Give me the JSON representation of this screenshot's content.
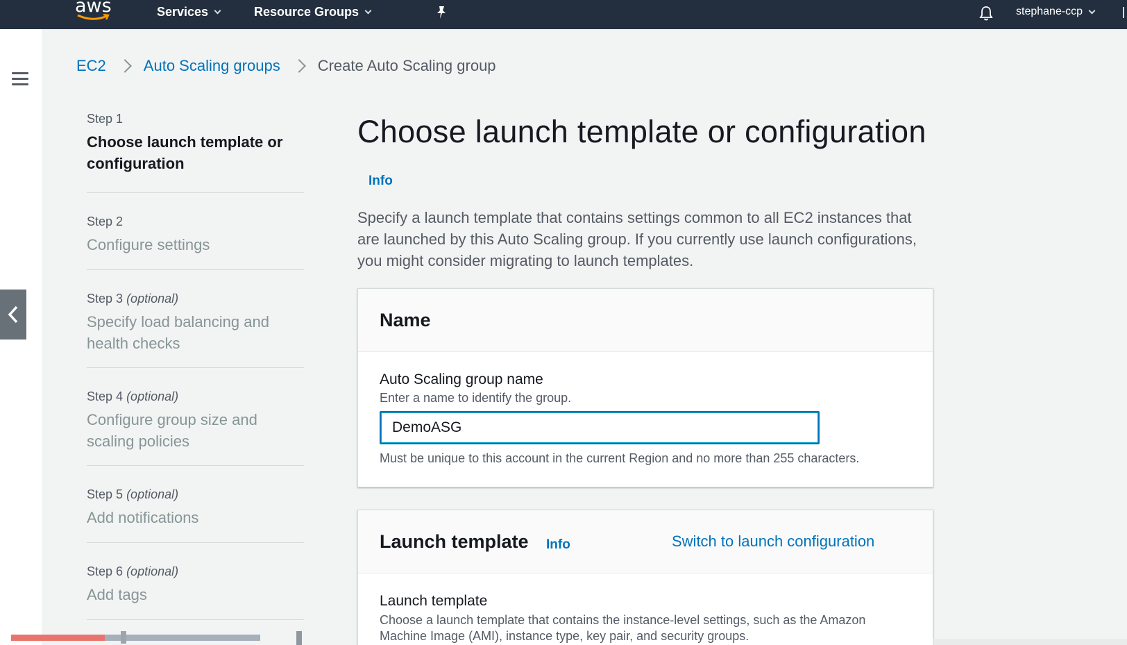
{
  "topnav": {
    "logo": "aws",
    "services": "Services",
    "resource_groups": "Resource Groups",
    "user": "stephane-ccp",
    "icons": [
      "pin-icon",
      "bell-icon"
    ]
  },
  "breadcrumb": {
    "items": [
      "EC2",
      "Auto Scaling groups"
    ],
    "current": "Create Auto Scaling group"
  },
  "steps": [
    {
      "num": "Step 1",
      "optional": "",
      "title": "Choose launch template or configuration"
    },
    {
      "num": "Step 2",
      "optional": "",
      "title": "Configure settings"
    },
    {
      "num": "Step 3",
      "optional": "(optional)",
      "title": "Specify load balancing and health checks"
    },
    {
      "num": "Step 4",
      "optional": "(optional)",
      "title": "Configure group size and scaling policies"
    },
    {
      "num": "Step 5",
      "optional": "(optional)",
      "title": "Add notifications"
    },
    {
      "num": "Step 6",
      "optional": "(optional)",
      "title": "Add tags"
    }
  ],
  "main": {
    "title": "Choose launch template or configuration",
    "info": "Info",
    "description": "Specify a launch template that contains settings common to all EC2 instances that are launched by this Auto Scaling group. If you currently use launch configurations, you might consider migrating to launch templates."
  },
  "name_card": {
    "title": "Name",
    "field_label": "Auto Scaling group name",
    "field_desc": "Enter a name to identify the group.",
    "value": "DemoASG",
    "constraint": "Must be unique to this account in the current Region and no more than 255 characters."
  },
  "launch_card": {
    "title": "Launch template",
    "info": "Info",
    "switch_link": "Switch to launch configuration",
    "field_label": "Launch template",
    "field_desc": "Choose a launch template that contains the instance-level settings, such as the Amazon Machine Image (AMI), instance type, key pair, and security groups."
  },
  "colors": {
    "nav_bg": "#232f3e",
    "link": "#0073bb",
    "page_bg": "#f2f3f3"
  }
}
